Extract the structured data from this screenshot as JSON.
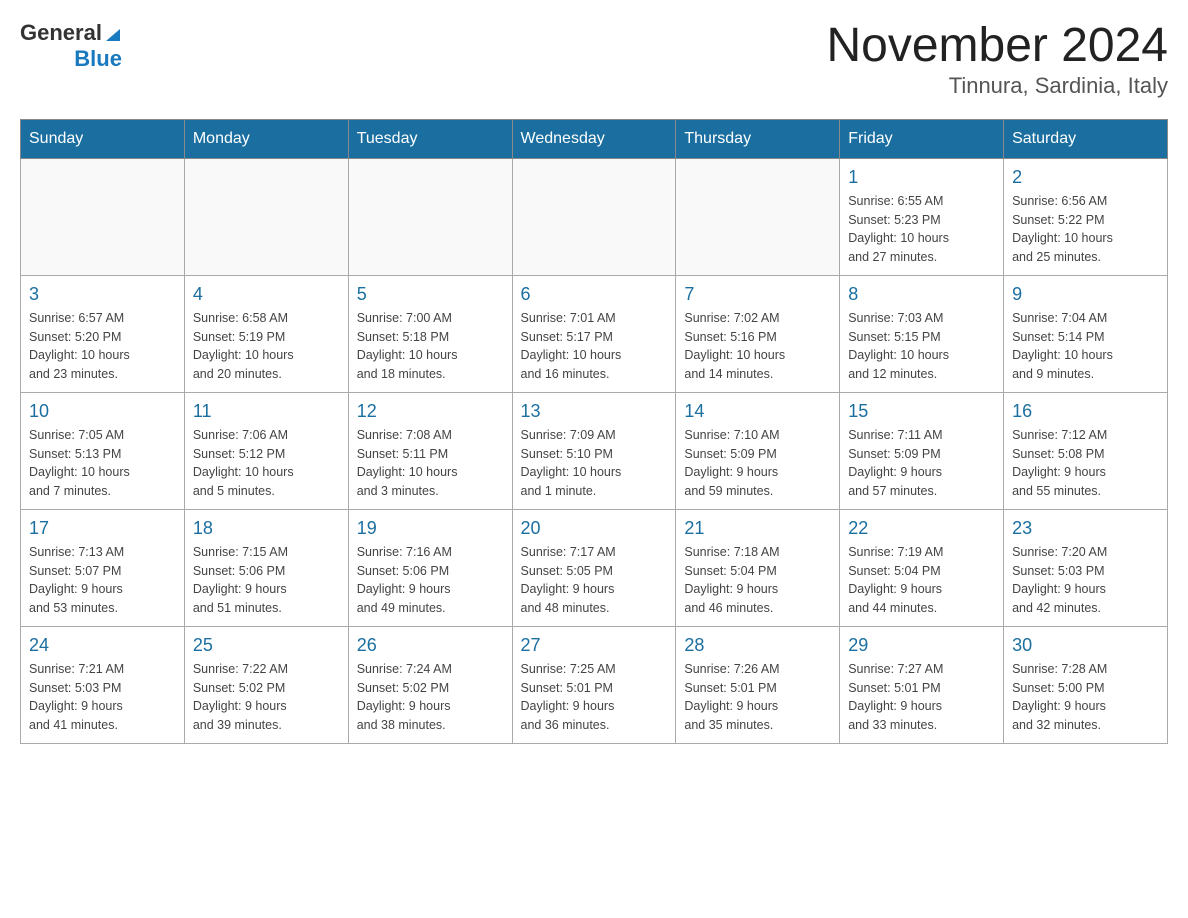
{
  "header": {
    "logo_general": "General",
    "logo_blue": "Blue",
    "month_title": "November 2024",
    "location": "Tinnura, Sardinia, Italy"
  },
  "weekdays": [
    "Sunday",
    "Monday",
    "Tuesday",
    "Wednesday",
    "Thursday",
    "Friday",
    "Saturday"
  ],
  "weeks": [
    [
      {
        "day": "",
        "info": ""
      },
      {
        "day": "",
        "info": ""
      },
      {
        "day": "",
        "info": ""
      },
      {
        "day": "",
        "info": ""
      },
      {
        "day": "",
        "info": ""
      },
      {
        "day": "1",
        "info": "Sunrise: 6:55 AM\nSunset: 5:23 PM\nDaylight: 10 hours\nand 27 minutes."
      },
      {
        "day": "2",
        "info": "Sunrise: 6:56 AM\nSunset: 5:22 PM\nDaylight: 10 hours\nand 25 minutes."
      }
    ],
    [
      {
        "day": "3",
        "info": "Sunrise: 6:57 AM\nSunset: 5:20 PM\nDaylight: 10 hours\nand 23 minutes."
      },
      {
        "day": "4",
        "info": "Sunrise: 6:58 AM\nSunset: 5:19 PM\nDaylight: 10 hours\nand 20 minutes."
      },
      {
        "day": "5",
        "info": "Sunrise: 7:00 AM\nSunset: 5:18 PM\nDaylight: 10 hours\nand 18 minutes."
      },
      {
        "day": "6",
        "info": "Sunrise: 7:01 AM\nSunset: 5:17 PM\nDaylight: 10 hours\nand 16 minutes."
      },
      {
        "day": "7",
        "info": "Sunrise: 7:02 AM\nSunset: 5:16 PM\nDaylight: 10 hours\nand 14 minutes."
      },
      {
        "day": "8",
        "info": "Sunrise: 7:03 AM\nSunset: 5:15 PM\nDaylight: 10 hours\nand 12 minutes."
      },
      {
        "day": "9",
        "info": "Sunrise: 7:04 AM\nSunset: 5:14 PM\nDaylight: 10 hours\nand 9 minutes."
      }
    ],
    [
      {
        "day": "10",
        "info": "Sunrise: 7:05 AM\nSunset: 5:13 PM\nDaylight: 10 hours\nand 7 minutes."
      },
      {
        "day": "11",
        "info": "Sunrise: 7:06 AM\nSunset: 5:12 PM\nDaylight: 10 hours\nand 5 minutes."
      },
      {
        "day": "12",
        "info": "Sunrise: 7:08 AM\nSunset: 5:11 PM\nDaylight: 10 hours\nand 3 minutes."
      },
      {
        "day": "13",
        "info": "Sunrise: 7:09 AM\nSunset: 5:10 PM\nDaylight: 10 hours\nand 1 minute."
      },
      {
        "day": "14",
        "info": "Sunrise: 7:10 AM\nSunset: 5:09 PM\nDaylight: 9 hours\nand 59 minutes."
      },
      {
        "day": "15",
        "info": "Sunrise: 7:11 AM\nSunset: 5:09 PM\nDaylight: 9 hours\nand 57 minutes."
      },
      {
        "day": "16",
        "info": "Sunrise: 7:12 AM\nSunset: 5:08 PM\nDaylight: 9 hours\nand 55 minutes."
      }
    ],
    [
      {
        "day": "17",
        "info": "Sunrise: 7:13 AM\nSunset: 5:07 PM\nDaylight: 9 hours\nand 53 minutes."
      },
      {
        "day": "18",
        "info": "Sunrise: 7:15 AM\nSunset: 5:06 PM\nDaylight: 9 hours\nand 51 minutes."
      },
      {
        "day": "19",
        "info": "Sunrise: 7:16 AM\nSunset: 5:06 PM\nDaylight: 9 hours\nand 49 minutes."
      },
      {
        "day": "20",
        "info": "Sunrise: 7:17 AM\nSunset: 5:05 PM\nDaylight: 9 hours\nand 48 minutes."
      },
      {
        "day": "21",
        "info": "Sunrise: 7:18 AM\nSunset: 5:04 PM\nDaylight: 9 hours\nand 46 minutes."
      },
      {
        "day": "22",
        "info": "Sunrise: 7:19 AM\nSunset: 5:04 PM\nDaylight: 9 hours\nand 44 minutes."
      },
      {
        "day": "23",
        "info": "Sunrise: 7:20 AM\nSunset: 5:03 PM\nDaylight: 9 hours\nand 42 minutes."
      }
    ],
    [
      {
        "day": "24",
        "info": "Sunrise: 7:21 AM\nSunset: 5:03 PM\nDaylight: 9 hours\nand 41 minutes."
      },
      {
        "day": "25",
        "info": "Sunrise: 7:22 AM\nSunset: 5:02 PM\nDaylight: 9 hours\nand 39 minutes."
      },
      {
        "day": "26",
        "info": "Sunrise: 7:24 AM\nSunset: 5:02 PM\nDaylight: 9 hours\nand 38 minutes."
      },
      {
        "day": "27",
        "info": "Sunrise: 7:25 AM\nSunset: 5:01 PM\nDaylight: 9 hours\nand 36 minutes."
      },
      {
        "day": "28",
        "info": "Sunrise: 7:26 AM\nSunset: 5:01 PM\nDaylight: 9 hours\nand 35 minutes."
      },
      {
        "day": "29",
        "info": "Sunrise: 7:27 AM\nSunset: 5:01 PM\nDaylight: 9 hours\nand 33 minutes."
      },
      {
        "day": "30",
        "info": "Sunrise: 7:28 AM\nSunset: 5:00 PM\nDaylight: 9 hours\nand 32 minutes."
      }
    ]
  ]
}
